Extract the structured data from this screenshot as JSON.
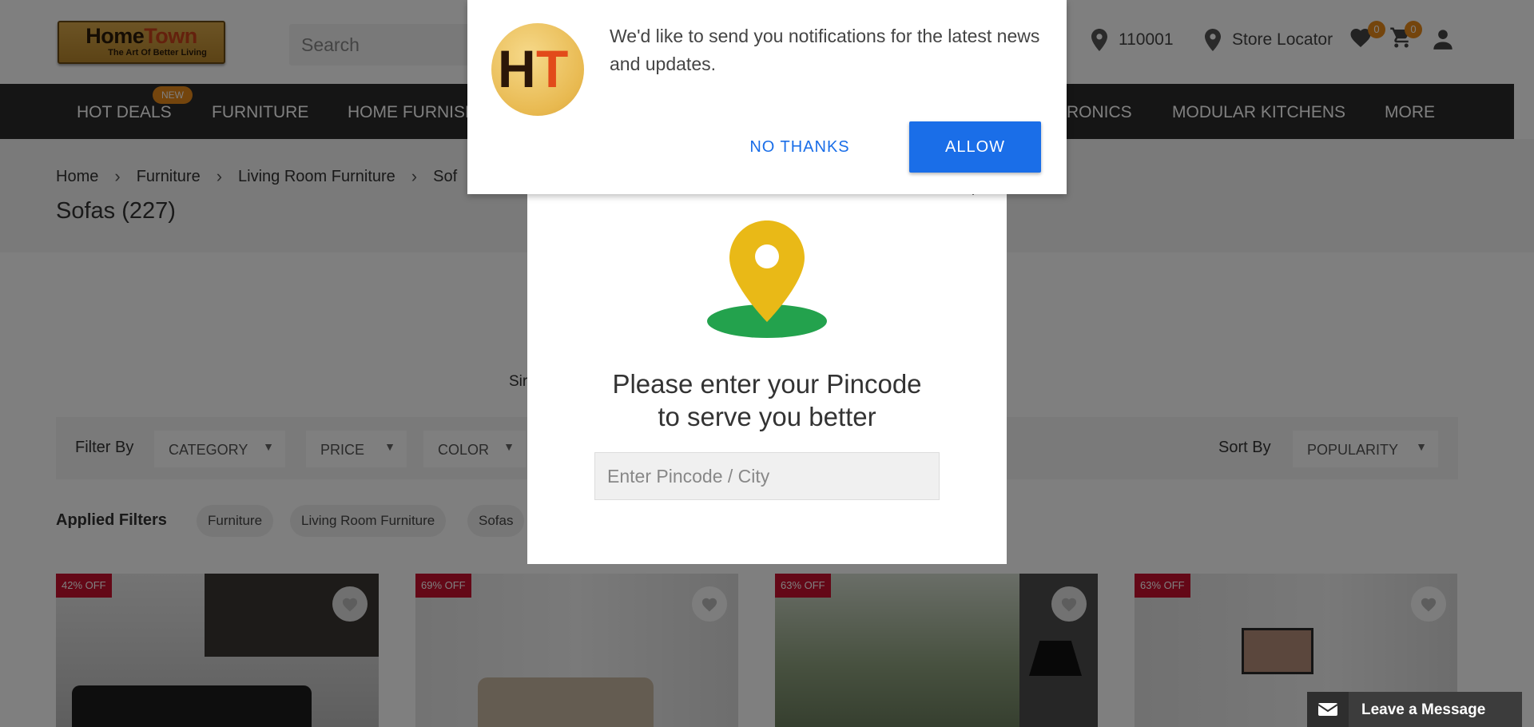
{
  "header": {
    "logo_text_home": "Home",
    "logo_text_town": "Town",
    "logo_tagline": "The Art Of Better Living",
    "search_placeholder": "Search",
    "pincode": "110001",
    "store_locator": "Store Locator",
    "wishlist_count": "0",
    "cart_count": "0"
  },
  "nav": {
    "items": [
      "HOT DEALS",
      "FURNITURE",
      "HOME FURNISHINGS",
      "ELECTRONICS",
      "MODULAR KITCHENS",
      "MORE"
    ],
    "new_badge": "NEW",
    "visible_fragments": {
      "home_furnishings": "HOME FURNISH",
      "electronics": "RONICS"
    }
  },
  "breadcrumb": {
    "items": [
      "Home",
      "Furniture",
      "Living Room Furniture",
      "Sofas"
    ],
    "last_fragment": "Sof",
    "separator": "›"
  },
  "page_title": "Sofas (227)",
  "similar_fragment": "Sir",
  "filters": {
    "label": "Filter By",
    "dropdowns": [
      "CATEGORY",
      "PRICE",
      "COLOR"
    ],
    "sort_label": "Sort By",
    "sort_value": "POPULARITY"
  },
  "applied_filters": {
    "label": "Applied Filters",
    "chips": [
      "Furniture",
      "Living Room Furniture",
      "Sofas"
    ]
  },
  "products": [
    {
      "discount": "42% OFF"
    },
    {
      "discount": "69% OFF"
    },
    {
      "discount": "63% OFF"
    },
    {
      "discount": "63% OFF"
    }
  ],
  "notification_prompt": {
    "logo_letters": [
      "H",
      "T"
    ],
    "message": "We'd like to send you notifications for the latest news and updates.",
    "decline_label": "NO THANKS",
    "allow_label": "ALLOW",
    "colors": {
      "allow_bg": "#1a6ee8",
      "decline_text": "#1a6ee8"
    }
  },
  "pincode_modal": {
    "heading_line1": "Please enter your Pincode",
    "heading_line2": "to serve you better",
    "input_placeholder": "Enter Pincode / City",
    "colors": {
      "pin": "#e9b917",
      "ground": "#23a24d"
    }
  },
  "chat_widget": {
    "label": "Leave a Message"
  },
  "colors": {
    "nav_bg": "#2b2b2b",
    "badge": "#e88a1a",
    "discount_bg": "#c8102e"
  }
}
